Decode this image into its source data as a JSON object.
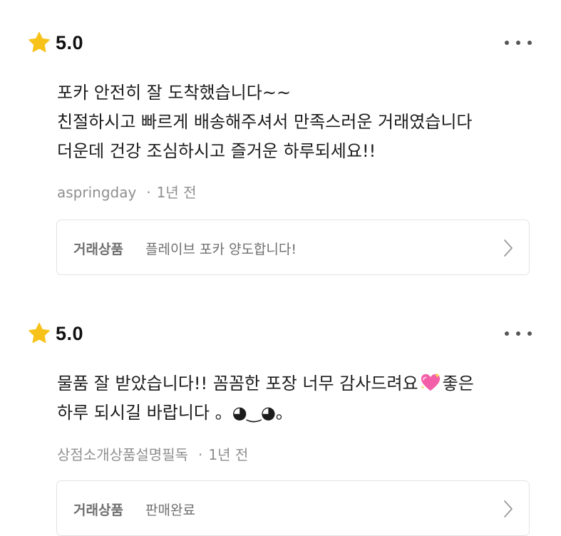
{
  "reviews": [
    {
      "rating": "5.0",
      "lines": [
        "포카 안전히 잘 도착했습니다~~",
        "친절하시고 빠르게 배송해주셔서 만족스러운 거래였습니다",
        "더운데 건강 조심하시고 즐거운 하루되세요!!"
      ],
      "author": "aspringday",
      "separator": "·",
      "time": "1년 전",
      "product_label": "거래상품",
      "product_name": "플레이브 포카 양도합니다!"
    },
    {
      "rating": "5.0",
      "line1_before": "물품 잘 받았습니다!! 꼼꼼한 포장 너무 감사드려요",
      "line1_after": "좋은",
      "line2": "하루 되시길 바랍니다 。◕‿◕。",
      "author": "상점소개상품설명필독",
      "separator": "·",
      "time": "1년 전",
      "product_label": "거래상품",
      "product_name": "판매완료"
    }
  ],
  "icons": {
    "star": "star-icon",
    "more": "more-options-icon",
    "chevron": "chevron-right-icon",
    "heart": "sparkling-heart-icon"
  },
  "colors": {
    "star": "#F7C31B",
    "heart": "#F25FA8",
    "meta_text": "#8F8F8F",
    "card_border": "#E3E3E3"
  }
}
